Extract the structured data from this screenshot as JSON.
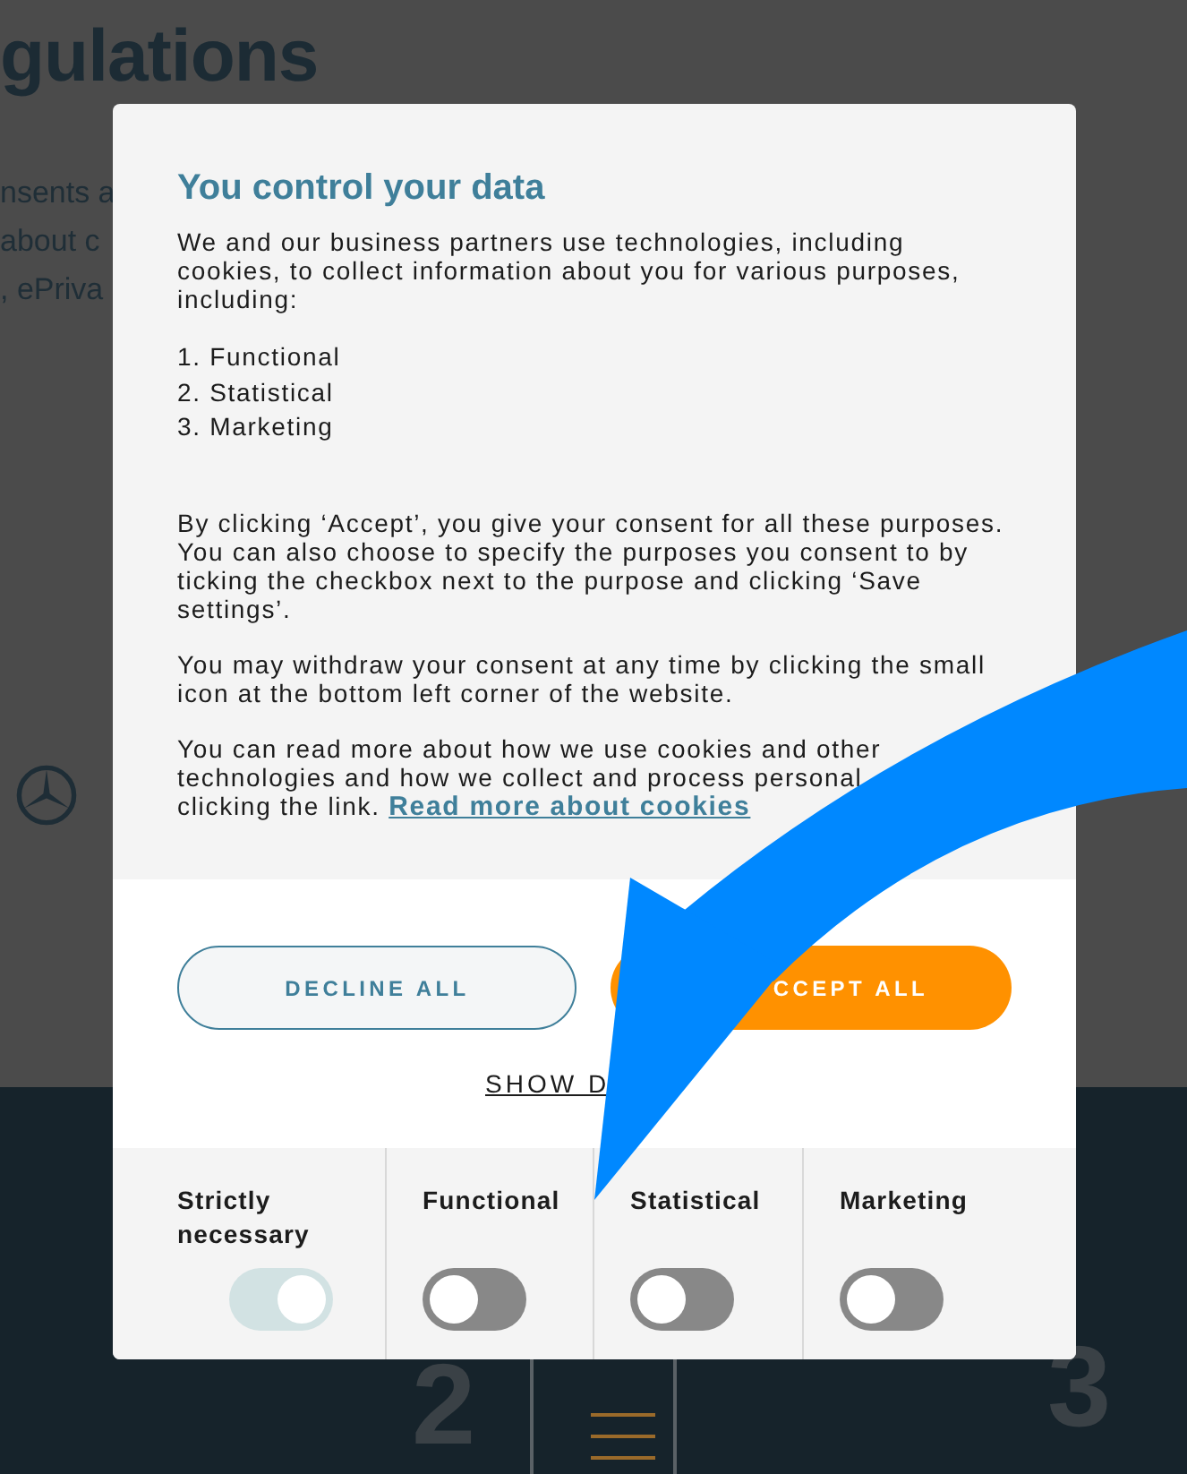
{
  "background_page": {
    "heading": "gulations",
    "intro_lines": [
      "nsents a",
      "about c",
      ", ePriva"
    ],
    "step_numbers": [
      "2",
      "3"
    ]
  },
  "dialog": {
    "title": "You control your data",
    "blocks": [
      {
        "kind": "paragraph",
        "lines": [
          "We and our business partners use technologies, including cookies, to collect information about you for various purposes, including:"
        ]
      },
      {
        "kind": "list",
        "items": [
          "1. Functional",
          "2. Statistical",
          "3. Marketing"
        ]
      },
      {
        "kind": "paragraph",
        "lines": [
          "By clicking ‘Accept’, you give your consent for all these purposes. You can also choose to specify the purposes you consent to by ticking the checkbox next to the purpose and clicking ‘Save settings’."
        ]
      },
      {
        "kind": "paragraph",
        "lines": [
          "You may withdraw your consent at any time by clicking the small icon at the bottom left corner of the website."
        ]
      },
      {
        "kind": "paragraph",
        "lines": [
          "You can read more about how we use cookies and other",
          "technologies and how we collect and process personal",
          "clicking the link."
        ],
        "link": "Read more about cookies"
      }
    ],
    "buttons": [
      {
        "label": "DECLINE ALL",
        "kind": "outline"
      },
      {
        "label": "CCEPT ALL",
        "kind": "primary"
      }
    ],
    "details_link": "SHOW D",
    "toggles": [
      {
        "label": "Strictly necessary",
        "on": true,
        "disabled": true
      },
      {
        "label": "Functional",
        "on": false,
        "disabled": false
      },
      {
        "label": "Statistical",
        "on": false,
        "disabled": false
      },
      {
        "label": "Marketing",
        "on": false,
        "disabled": false
      }
    ]
  }
}
